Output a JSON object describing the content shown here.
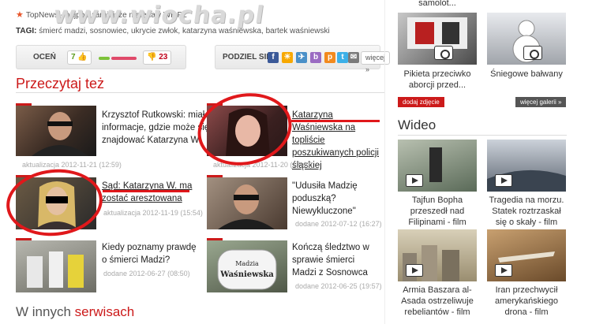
{
  "watermark": "www.wiocha.pl",
  "topnews": "TopNews - najpopularniejsze materiały WP.PL",
  "tags": {
    "label": "TAGI:",
    "values": "śmierć madzi, sosnowiec, ukrycie zwłok, katarzyna waśniewska, bartek waśniewski"
  },
  "rating": {
    "label": "OCEŃ",
    "up": "7",
    "down": "23",
    "colors": {
      "up": "#5a9a1a",
      "down": "#c0001a"
    }
  },
  "share": {
    "label": "PODZIEL SIĘ",
    "more": "więcej »",
    "icons": [
      "facebook-icon",
      "sun-icon",
      "bird-icon",
      "blip-icon",
      "pinger-icon",
      "twitter-icon",
      "email-icon"
    ]
  },
  "section_title": "Przeczytaj też",
  "articles": [
    {
      "title": "Krzysztof Rutkowski: miałem informacje, gdzie może się znajdować Katarzyna W.",
      "date": "aktualizacja 2012-11-21 (12:59)"
    },
    {
      "title": "Katarzyna Waśniewska na topliście poszukiwanych policji śląskiej",
      "date": "aktualizacja 2012-11-20 (17:40)"
    },
    {
      "title": "Sąd: Katarzyna W. ma zostać aresztowana",
      "date": "aktualizacja 2012-11-19 (15:54)"
    },
    {
      "title": "\"Udusiła Madzię poduszką? Niewykluczone\"",
      "date": "dodane 2012-07-12 (16:27)"
    },
    {
      "title": "Kiedy poznamy prawdę o śmierci Madzi?",
      "date": "dodane 2012-06-27 (08:50)"
    },
    {
      "title": "Kończą śledztwo w sprawie śmierci Madzi z Sosnowca",
      "date": "dodane 2012-06-25 (19:57)"
    }
  ],
  "sign": {
    "line1": "Madzia",
    "line2": "Waśniewska"
  },
  "other_services": {
    "prefix": "W innych",
    "bold": "serwisach"
  },
  "gallery": {
    "top_caption": "samolot...",
    "items": [
      {
        "caption": "Pikieta przeciwko aborcji przed..."
      },
      {
        "caption": "Śniegowe bałwany"
      }
    ],
    "add_photo": "dodaj zdjęcie",
    "more": "więcej galerii »"
  },
  "video": {
    "title": "Wideo",
    "items": [
      {
        "caption": "Tajfun Bopha przeszedł nad Filipinami - film"
      },
      {
        "caption": "Tragedia na morzu. Statek roztrzaskał się o skały - film"
      },
      {
        "caption": "Armia Baszara al-Asada ostrzeliwuje rebeliantów - film"
      },
      {
        "caption": "Iran przechwycił amerykańskiego drona - film"
      }
    ]
  }
}
